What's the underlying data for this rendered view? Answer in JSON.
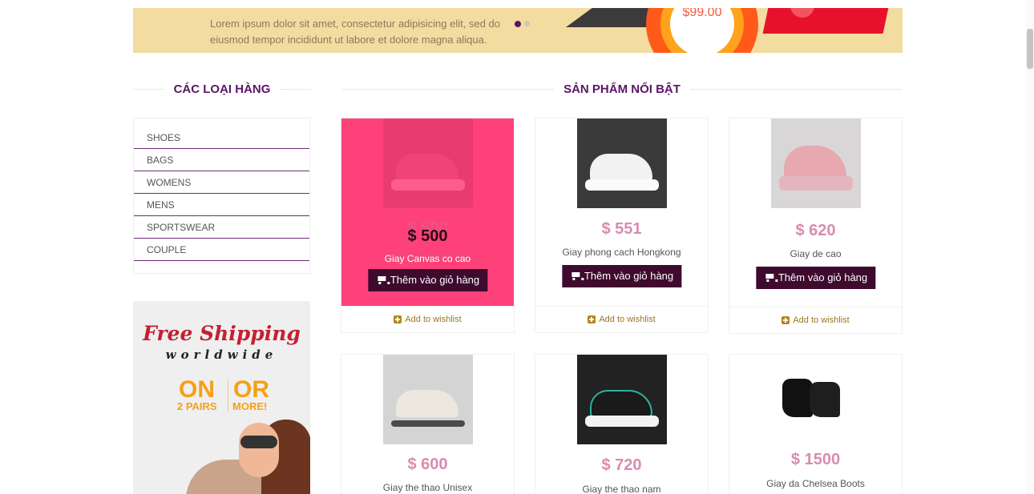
{
  "hero": {
    "text": "Lorem ipsum dolor sit amet, consectetur adipisicing elit, sed do eiusmod tempor incididunt ut labore et dolore magna aliqua.",
    "price": "$99.00",
    "colors": {
      "background": "#f3dca0",
      "accent": "#ff5a1a"
    }
  },
  "sidebar": {
    "heading": "CÁC LOẠI HÀNG",
    "categories": [
      "SHOES",
      "BAGS",
      "WOMENS",
      "MENS",
      "SPORTSWEAR",
      "COUPLE"
    ],
    "ad": {
      "title": "Free Shipping",
      "subtitle": "worldwide",
      "on": "ON",
      "or": "OR",
      "pairs": "2 PAIRS",
      "more": "MORE!"
    }
  },
  "featured": {
    "heading": "SẢN PHẨM NỔI BẬT",
    "cart_label": "Thêm vào giỏ hàng",
    "wishlist_label": "Add to wishlist",
    "products": [
      {
        "price": "$ 500",
        "name": "Giay Canvas co cao",
        "icon": "pink-sneaker"
      },
      {
        "price": "$ 551",
        "name": "Giay phong cach Hongkong",
        "icon": "white-sneaker"
      },
      {
        "price": "$ 620",
        "name": "Giay de cao",
        "icon": "pink-chunky-sneaker"
      },
      {
        "price": "$ 600",
        "name": "Giay the thao Unisex",
        "icon": "grey-running-shoe"
      },
      {
        "price": "$ 720",
        "name": "Giay the thao nam",
        "icon": "black-sport-shoe"
      },
      {
        "price": "$ 1500",
        "name": "Giay da Chelsea Boots",
        "icon": "black-chelsea-boots"
      }
    ]
  },
  "colors": {
    "heading": "#5c1468",
    "cart_button": "#3e0a2e",
    "hover_card": "#fe4179",
    "price": "#d88cb0",
    "wishlist": "#9a7820"
  }
}
